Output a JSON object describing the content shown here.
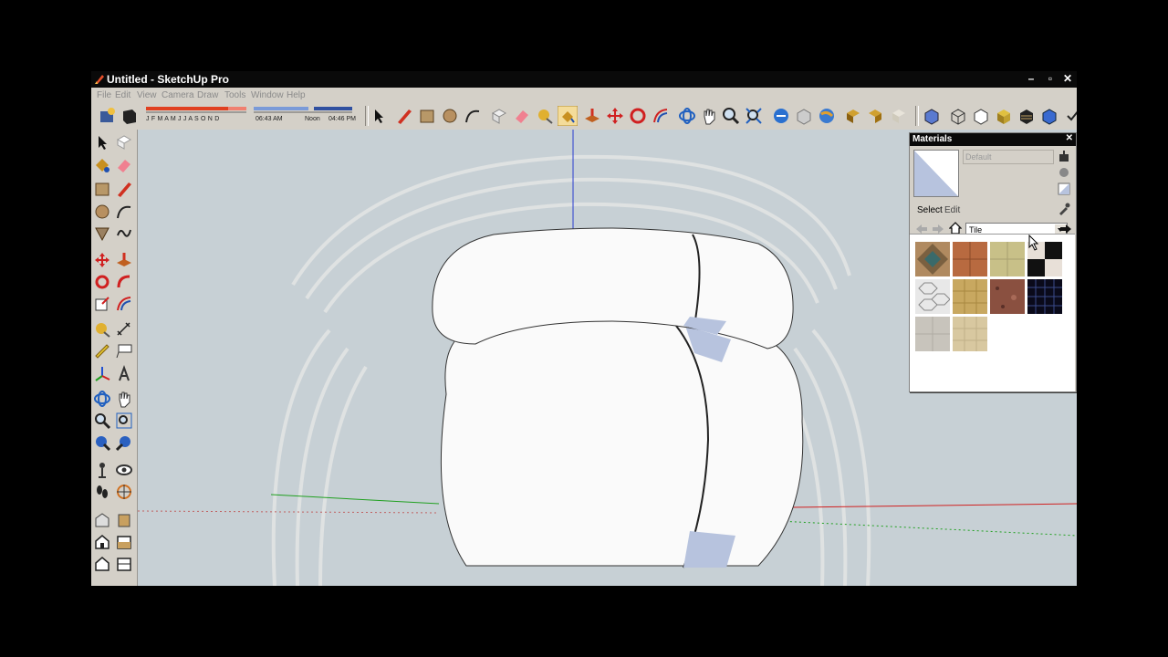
{
  "window": {
    "title": "Untitled - SketchUp Pro",
    "minimize": "–",
    "maximize": "▫",
    "close": "✕"
  },
  "menu": [
    "File",
    "Edit",
    "View",
    "Camera",
    "Draw",
    "Tools",
    "Window",
    "Help"
  ],
  "shadow": {
    "months": "J F M A M J J A S O N D",
    "time_start": "06:43 AM",
    "time_mid": "Noon",
    "time_end": "04:46 PM"
  },
  "materials": {
    "title": "Materials",
    "close": "✕",
    "name_placeholder": "Default",
    "tab_select": "Select",
    "tab_edit": "Edit",
    "collection": "Tile",
    "swatches": [
      "tile-diamond",
      "tile-terracotta",
      "tile-beige",
      "tile-checker-black-white",
      "tile-hexagon",
      "tile-tan-square",
      "tile-red-granite",
      "tile-blue-grid",
      "tile-gray-stone",
      "tile-sand-mosaic"
    ]
  },
  "colors": {
    "accent": "#b7c3de",
    "titlebar": "#0a0a0a",
    "viewport": "#c7d0d5",
    "panel": "#d4d0c8"
  }
}
